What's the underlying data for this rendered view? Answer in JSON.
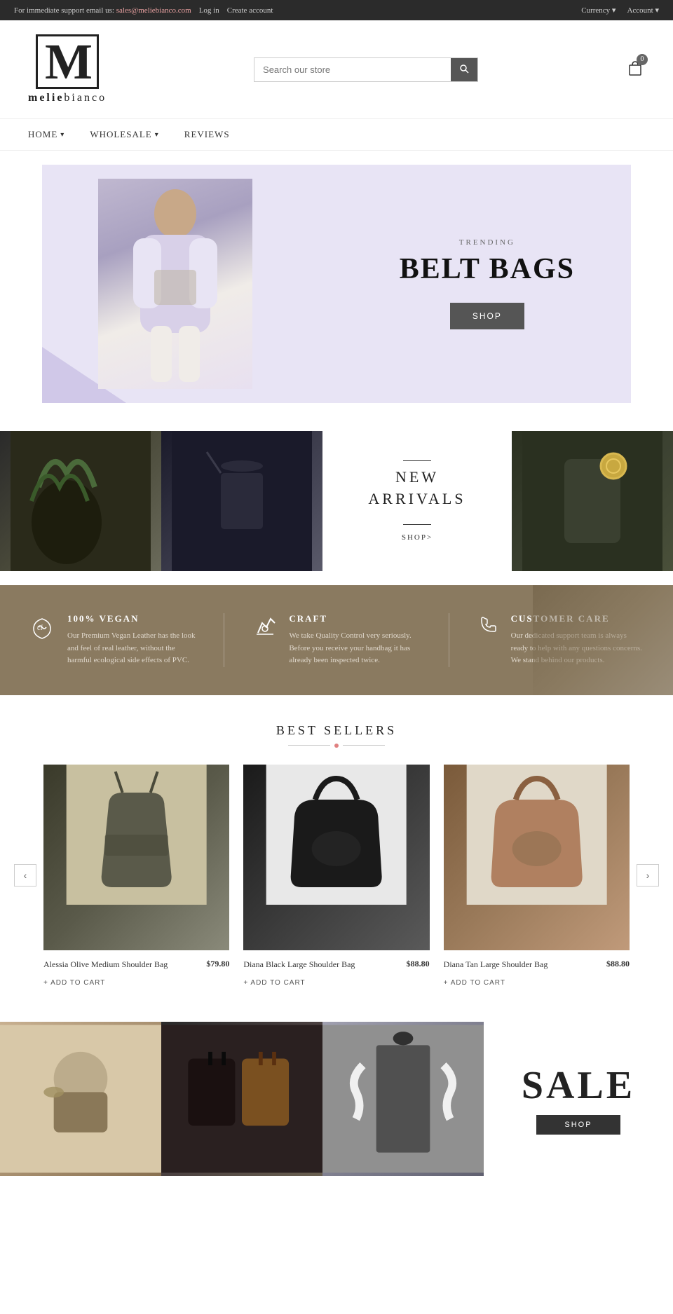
{
  "topbar": {
    "support_text": "For immediate support email us:",
    "email": "sales@meliebianco.com",
    "login": "Log in",
    "create_account": "Create account",
    "currency": "Currency ▾",
    "account": "Account ▾"
  },
  "header": {
    "logo_letter": "M",
    "logo_brand": "melie",
    "logo_brand2": "bianco",
    "search_placeholder": "Search our store",
    "search_label": "Search",
    "cart_count": "0"
  },
  "nav": {
    "items": [
      {
        "label": "HOME",
        "has_dropdown": true
      },
      {
        "label": "WHOLESALE",
        "has_dropdown": true
      },
      {
        "label": "REVIEWS",
        "has_dropdown": false
      }
    ]
  },
  "hero": {
    "trending_label": "TRENDING",
    "title": "BELT BAGS",
    "shop_btn": "SHOP"
  },
  "new_arrivals": {
    "title_line1": "NEW",
    "title_line2": "ARRIVALS",
    "shop_link": "SHOP>"
  },
  "features": {
    "items": [
      {
        "icon": "♡",
        "title": "100% VEGAN",
        "desc": "Our Premium Vegan Leather has the look and feel of real leather, without the harmful ecological side effects of PVC."
      },
      {
        "icon": "✂",
        "title": "CRAFT",
        "desc": "We take Quality Control very seriously. Before you receive your handbag it has already been inspected twice."
      },
      {
        "icon": "☎",
        "title": "CUSTOMER CARE",
        "desc": "Our dedicated support team is always ready to help with any questions concerns. We stand behind our products."
      }
    ]
  },
  "best_sellers": {
    "title": "BEST SELLERS",
    "prev_label": "‹",
    "next_label": "›",
    "products": [
      {
        "name": "Alessia Olive Medium Shoulder Bag",
        "price": "$79.80",
        "add_to_cart": "+ ADD TO CART",
        "img_class": "product-img-1"
      },
      {
        "name": "Diana Black Large Shoulder Bag",
        "price": "$88.80",
        "add_to_cart": "+ ADD TO CART",
        "img_class": "product-img-2"
      },
      {
        "name": "Diana Tan Large Shoulder Bag",
        "price": "$88.80",
        "add_to_cart": "+ ADD TO CART",
        "img_class": "product-img-3"
      }
    ]
  },
  "bottom_section": {
    "sale_text": "SALE",
    "shop_btn": "shop"
  }
}
